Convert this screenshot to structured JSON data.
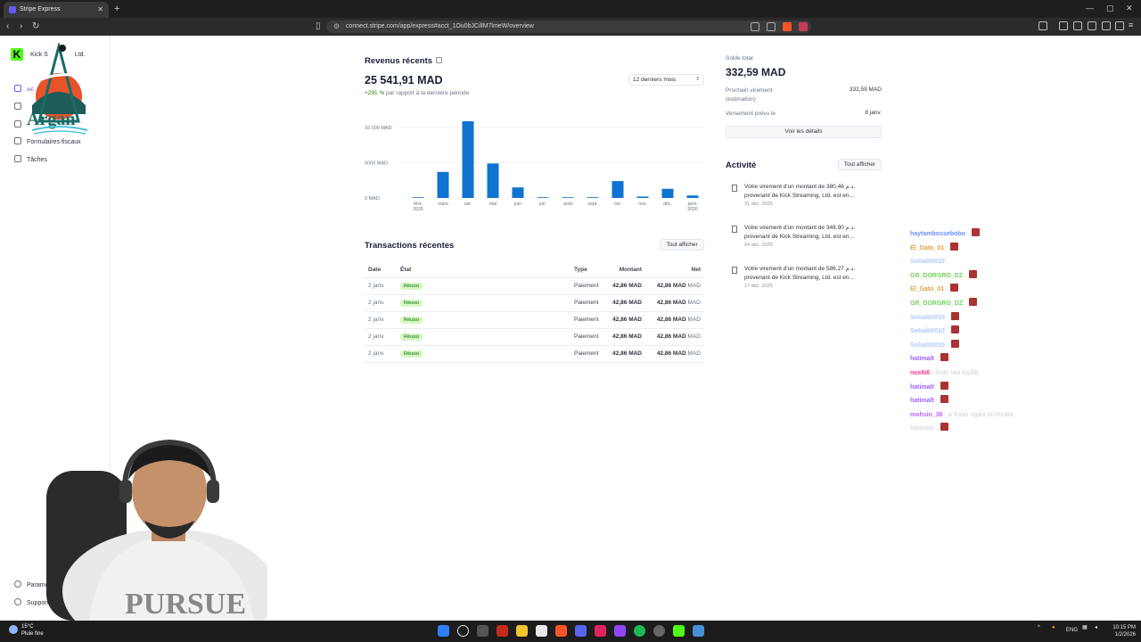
{
  "browser": {
    "tab_title": "Stripe Express",
    "url": "connect.stripe.com/app/express#acct_1Ou0bJCillM7lmeW/overview"
  },
  "sidebar": {
    "brand": "Kick Streaming, Ltd.",
    "brand_visible": "Kick S",
    "brand_tail": "Ltd.",
    "items": [
      {
        "label": "Ac",
        "icon": "home-icon"
      },
      {
        "label": "",
        "icon": "list-icon"
      },
      {
        "label": "",
        "icon": "transfer-icon"
      },
      {
        "label": "Formulaires fiscaux",
        "icon": "document-icon"
      },
      {
        "label": "Tâches",
        "icon": "tasks-icon"
      }
    ],
    "bottom": {
      "settings": "Paramètr",
      "support": "Support"
    }
  },
  "revenue": {
    "title": "Revenus récents",
    "amount": "25 541,91 MAD",
    "delta_pct": "+291 %",
    "delta_text": " par rapport à la dernière période",
    "period": "12 derniers mois"
  },
  "chart_data": {
    "type": "bar",
    "categories": [
      "févr. 2025",
      "mars",
      "avr.",
      "mai",
      "juin",
      "juil.",
      "août",
      "sept.",
      "oct.",
      "nov.",
      "déc.",
      "janv. 2026"
    ],
    "x_tick_lines": [
      [
        "févr.",
        "2025"
      ],
      [
        "mars"
      ],
      [
        "avr."
      ],
      [
        "mai"
      ],
      [
        "juin"
      ],
      [
        "juil."
      ],
      [
        "août"
      ],
      [
        "sept."
      ],
      [
        "oct."
      ],
      [
        "nov."
      ],
      [
        "déc."
      ],
      [
        "janv.",
        "2026"
      ]
    ],
    "values": [
      0,
      3700,
      10900,
      4900,
      1500,
      60,
      0,
      0,
      2400,
      200,
      1300,
      350
    ],
    "y_ticks": [
      "10 000 MAD",
      "5000 MAD",
      "0 MAD"
    ],
    "y_tick_values": [
      10000,
      5000,
      0
    ],
    "ylim": [
      0,
      10900
    ],
    "color": "#0f74d1"
  },
  "transactions": {
    "title": "Transactions récentes",
    "see_all": "Tout afficher",
    "columns": [
      "Date",
      "État",
      "Type",
      "Montant",
      "Net"
    ],
    "rows": [
      {
        "date": "2 janv.",
        "status": "Réussi",
        "type": "Paiement",
        "amount": "42,86 MAD",
        "net": "42,86 MAD",
        "cur": "MAD"
      },
      {
        "date": "2 janv.",
        "status": "Réussi",
        "type": "Paiement",
        "amount": "42,86 MAD",
        "net": "42,86 MAD",
        "cur": "MAD"
      },
      {
        "date": "2 janv.",
        "status": "Réussi",
        "type": "Paiement",
        "amount": "42,86 MAD",
        "net": "42,86 MAD",
        "cur": "MAD"
      },
      {
        "date": "2 janv.",
        "status": "Réussi",
        "type": "Paiement",
        "amount": "42,86 MAD",
        "net": "42,86 MAD",
        "cur": "MAD"
      },
      {
        "date": "2 janv.",
        "status": "Réussi",
        "type": "Paiement",
        "amount": "42,86 MAD",
        "net": "42,86 MAD",
        "cur": "MAD"
      }
    ]
  },
  "balance": {
    "label": "Solde total",
    "amount": "332,59 MAD",
    "next_payout_label": "Prochain virement",
    "next_payout_sub": "(estimation)",
    "next_payout_value": "332,59 MAD",
    "expected_label": "Versement prévu le",
    "expected_value": "8 janv.",
    "details_button": "Voir les détails"
  },
  "activity": {
    "title": "Activité",
    "see_all": "Tout afficher",
    "items": [
      {
        "text": "Votre virement d'un montant de 380.46 د.م. provenant de Kick Streaming, Ltd. est en…",
        "date": "31 déc. 2025"
      },
      {
        "text": "Votre virement d'un montant de 348.90 د.م. provenant de Kick Streaming, Ltd. est en…",
        "date": "24 déc. 2025"
      },
      {
        "text": "Votre virement d'un montant de 586.27 د.م. provenant de Kick Streaming, Ltd. est en…",
        "date": "17 déc. 2025"
      }
    ]
  },
  "chat": [
    {
      "user": "haytambossebobo",
      "msg": " :",
      "color": "#6b8cff",
      "emote": true
    },
    {
      "user": "El_Gato_01",
      "msg": " :",
      "color": "#e0a040",
      "emote": true
    },
    {
      "user": "Sohaib0010",
      "msg": " :",
      "color": "#b0c8ff",
      "emote": false
    },
    {
      "user": "GR_DORGRO_DZ",
      "msg": " :",
      "color": "#6fd35a",
      "emote": true
    },
    {
      "user": "El_Gato_01",
      "msg": " :",
      "color": "#e0a040",
      "emote": true
    },
    {
      "user": "GR_DORGRO_DZ",
      "msg": " :",
      "color": "#6fd35a",
      "emote": true
    },
    {
      "user": "Sohaib0010",
      "msg": " :",
      "color": "#b0c8ff",
      "emote": true
    },
    {
      "user": "Sohaib0010",
      "msg": " :",
      "color": "#b0c8ff",
      "emote": true
    },
    {
      "user": "Sohaib0010",
      "msg": " :",
      "color": "#b0c8ff",
      "emote": true
    },
    {
      "user": "hatimalt",
      "msg": " :",
      "color": "#a060ff",
      "emote": true
    },
    {
      "user": "nox6i6",
      "msg": " : 3ndo lala ba3lik",
      "color": "#ff3a8c",
      "emote": false
    },
    {
      "user": "hatimalt",
      "msg": " :",
      "color": "#a060ff",
      "emote": true
    },
    {
      "user": "hatimalt",
      "msg": " :",
      "color": "#a060ff",
      "emote": true
    },
    {
      "user": "mohsin_36",
      "msg": " : w fraan ngabi to7elnakk",
      "color": "#c060ff",
      "emote": false
    },
    {
      "user": "hatimalt",
      "msg": " :",
      "color": "#dcdcdc",
      "emote": true
    }
  ],
  "taskbar": {
    "temp": "15°C",
    "weather": "Pluie fine",
    "lang": "ENG",
    "time": "10:15 PM",
    "date": "1/2/2026"
  }
}
